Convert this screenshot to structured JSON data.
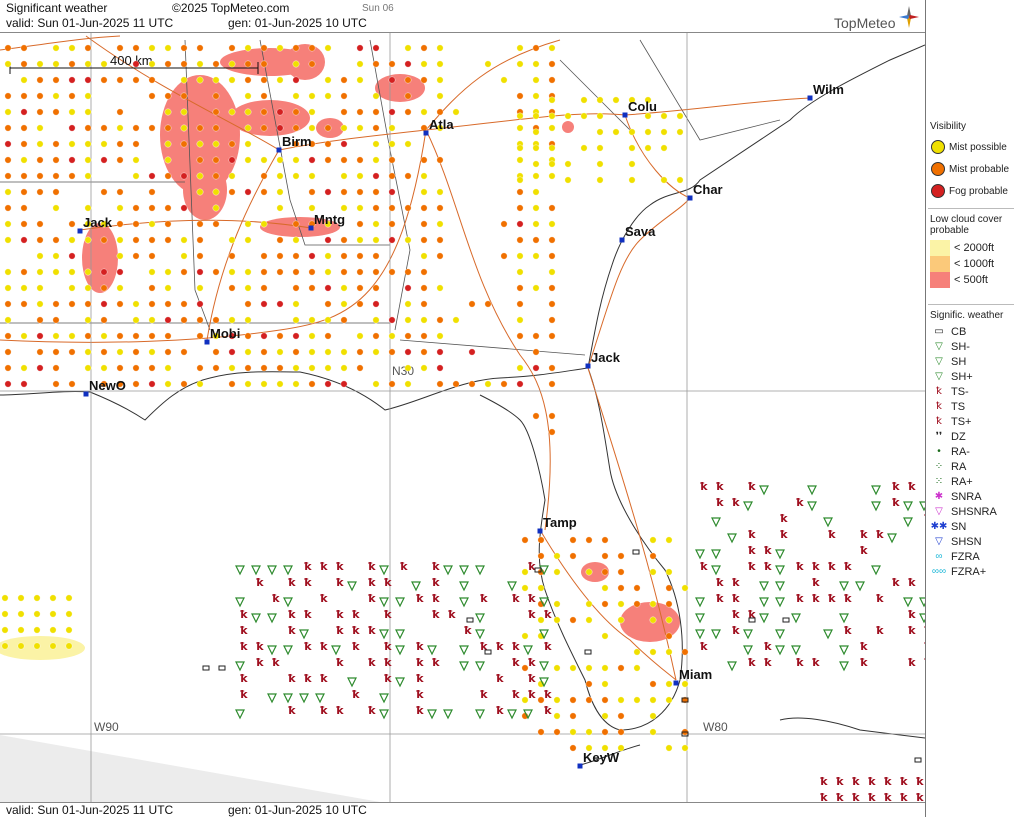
{
  "header": {
    "title": "Significant weather",
    "copyright": "©2025 TopMeteo.com",
    "day_tag": "Sun 06",
    "valid": "valid:  Sun  01-Jun-2025  11 UTC",
    "gen": "gen: 01-Jun-2025 10 UTC",
    "brand": "TopMeteo"
  },
  "footer": {
    "valid": "valid:  Sun  01-Jun-2025  11 UTC",
    "gen": "gen: 01-Jun-2025 10 UTC"
  },
  "map": {
    "scale_label": "400 km",
    "grid_labels": {
      "lat": "N30",
      "lon_w90": "W90",
      "lon_w80": "W80"
    },
    "cities": [
      {
        "name": "Wilm"
      },
      {
        "name": "Colu"
      },
      {
        "name": "Atla"
      },
      {
        "name": "Birm"
      },
      {
        "name": "Char"
      },
      {
        "name": "Jack"
      },
      {
        "name": "Mntg"
      },
      {
        "name": "Sava"
      },
      {
        "name": "Mobi"
      },
      {
        "name": "Jack"
      },
      {
        "name": "NewO"
      },
      {
        "name": "Tamp"
      },
      {
        "name": "Miam"
      },
      {
        "name": "KeyW"
      }
    ]
  },
  "legend": {
    "visibility": {
      "title": "Visibility",
      "items": [
        {
          "label": "Mist possible",
          "color": "#f0e000"
        },
        {
          "label": "Mist probable",
          "color": "#f07000"
        },
        {
          "label": "Fog probable",
          "color": "#d42020"
        }
      ]
    },
    "low_cloud": {
      "title": "Low cloud cover probable",
      "items": [
        {
          "label": "< 2000ft",
          "color": "#fbf3a6"
        },
        {
          "label": "< 1000ft",
          "color": "#fbc97a"
        },
        {
          "label": "<   500ft",
          "color": "#f6807a"
        }
      ]
    },
    "sig_weather": {
      "title": "Signific. weather",
      "items": [
        {
          "label": "CB",
          "color": "#222222"
        },
        {
          "label": "SH-",
          "color": "#2e8b2e"
        },
        {
          "label": "SH",
          "color": "#2e8b2e"
        },
        {
          "label": "SH+",
          "color": "#2e8b2e"
        },
        {
          "label": "TS-",
          "color": "#a01020"
        },
        {
          "label": "TS",
          "color": "#a01020"
        },
        {
          "label": "TS+",
          "color": "#a01020"
        },
        {
          "label": "DZ",
          "color": "#222222"
        },
        {
          "label": "RA-",
          "color": "#1a6a1a"
        },
        {
          "label": "RA",
          "color": "#1a6a1a"
        },
        {
          "label": "RA+",
          "color": "#1a6a1a"
        },
        {
          "label": "SNRA",
          "color": "#cc33cc"
        },
        {
          "label": "SHSNRA",
          "color": "#cc33cc"
        },
        {
          "label": "SN",
          "color": "#2040d0"
        },
        {
          "label": "SHSN",
          "color": "#2040d0"
        },
        {
          "label": "FZRA",
          "color": "#20b8d8"
        },
        {
          "label": "FZRA+",
          "color": "#20b8d8"
        }
      ]
    }
  }
}
